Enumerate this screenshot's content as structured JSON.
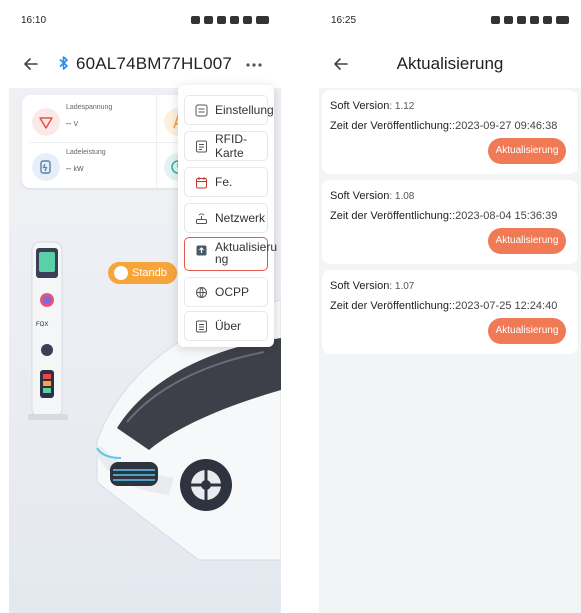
{
  "left": {
    "status_time": "16:10",
    "title": "60AL74BM77HL007",
    "stats": {
      "ladespannung_label": "Ladespannung",
      "ladespannung_value": "–",
      "ladespannung_unit": "V",
      "ladeleistung_label": "Ladeleistung",
      "ladeleistung_value": "–",
      "ladeleistung_unit": "kW"
    },
    "standby_label": "Standb",
    "menu": [
      {
        "label": "Einstellung",
        "icon": "settings-list-icon"
      },
      {
        "label": "RFID-Karte",
        "icon": "card-icon"
      },
      {
        "label": "Fe.",
        "icon": "calendar-icon"
      },
      {
        "label": "Netzwerk",
        "icon": "router-icon"
      },
      {
        "label": "Aktualisieru ng",
        "icon": "update-icon"
      },
      {
        "label": "OCPP",
        "icon": "globe-icon"
      },
      {
        "label": "Über",
        "icon": "info-document-icon"
      }
    ],
    "menu_active_index": 4
  },
  "right": {
    "status_time": "16:25",
    "title": "Aktualisierung",
    "versions": [
      {
        "soft_label": "Soft Version",
        "soft_value": ": 1.12",
        "date_label": "Zeit der Veröffentlichung:",
        "date_value": ":2023-09-27 09:46:38",
        "button": "Aktualisierung"
      },
      {
        "soft_label": "Soft Version",
        "soft_value": ": 1.08",
        "date_label": "Zeit der Veröffentlichung:",
        "date_value": ":2023-08-04 15:36:39",
        "button": "Aktualisierung"
      },
      {
        "soft_label": "Soft Version",
        "soft_value": ": 1.07",
        "date_label": "Zeit der Veröffentlichung:",
        "date_value": ":2023-07-25 12:24:40",
        "button": "Aktualisierung"
      }
    ]
  },
  "colors": {
    "accent_orange": "#f07a55",
    "standby_orange": "#f6a53b",
    "bluetooth_blue": "#2a8bf2",
    "active_border_red": "#e05a4f"
  }
}
